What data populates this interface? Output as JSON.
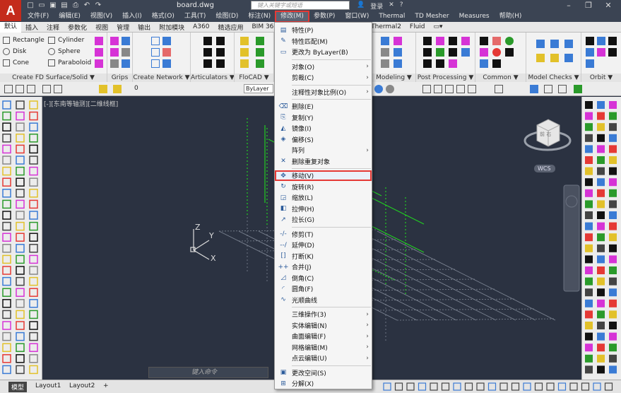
{
  "app": {
    "logo_letter": "A",
    "doc_title": "board.dwg",
    "search_placeholder": "键入关键字或短语",
    "login_label": "登录",
    "help_symbol": "?"
  },
  "menubar": {
    "items": [
      {
        "label": "文件(F)"
      },
      {
        "label": "编辑(E)"
      },
      {
        "label": "视图(V)"
      },
      {
        "label": "插入(I)"
      },
      {
        "label": "格式(O)"
      },
      {
        "label": "工具(T)"
      },
      {
        "label": "绘图(D)"
      },
      {
        "label": "标注(N)"
      },
      {
        "label": "修改(M)"
      },
      {
        "label": "参数(P)"
      },
      {
        "label": "窗口(W)"
      },
      {
        "label": "Thermal"
      },
      {
        "label": "TD Mesher"
      },
      {
        "label": "Measures"
      },
      {
        "label": "帮助(H)"
      }
    ],
    "active_index": 8
  },
  "ribbon_tabs": {
    "items": [
      "默认",
      "插入",
      "注释",
      "参数化",
      "视图",
      "管理",
      "输出",
      "附加模块",
      "A360",
      "精选应用",
      "BIM 360",
      "Thermal2",
      "Fluid"
    ],
    "selected": 0
  },
  "ribbon_panels": {
    "fd": {
      "title": "Create FD Surface/Solid ▼",
      "shapes": [
        {
          "label": "Rectangle"
        },
        {
          "label": "Disk"
        },
        {
          "label": "Cone"
        },
        {
          "label": "Cylinder"
        },
        {
          "label": "Sphere"
        },
        {
          "label": "Paraboloid"
        }
      ]
    },
    "grips": {
      "title": "Grips"
    },
    "network": {
      "title": "Create Network ▼"
    },
    "articulators": {
      "title": "Articulators ▼"
    },
    "flocad": {
      "title": "FloCAD ▼"
    },
    "modeling": {
      "title": "Modeling ▼"
    },
    "post": {
      "title": "Post Processing ▼"
    },
    "common": {
      "title": "Common ▼"
    },
    "model_checks": {
      "title": "Model Checks ▼"
    },
    "orbit": {
      "title": "Orbit ▼"
    }
  },
  "toolbar2": {
    "layer_value": "0",
    "bylayer": "ByLayer"
  },
  "viewport": {
    "label": "[-][东南等轴测][二维线框]",
    "wcs": "WCS",
    "cube_text": "前 右"
  },
  "dropdown": {
    "items": [
      {
        "icon": "▤",
        "label": "特性(P)",
        "submenu": false
      },
      {
        "icon": "✎",
        "label": "特性匹配(M)",
        "submenu": false
      },
      {
        "icon": "▭",
        "label": "更改为 ByLayer(B)",
        "submenu": false
      },
      {
        "icon": "",
        "label": "对象(O)",
        "submenu": true
      },
      {
        "icon": "",
        "label": "剪裁(C)",
        "submenu": true
      },
      {
        "icon": "",
        "label": "注释性对象比例(O)",
        "submenu": true
      },
      {
        "icon": "⌫",
        "label": "删除(E)",
        "submenu": false
      },
      {
        "icon": "⎘",
        "label": "复制(Y)",
        "submenu": false
      },
      {
        "icon": "◭",
        "label": "镜像(I)",
        "submenu": false
      },
      {
        "icon": "◈",
        "label": "偏移(S)",
        "submenu": false
      },
      {
        "icon": "",
        "label": "阵列",
        "submenu": true
      },
      {
        "icon": "✕",
        "label": "删除重复对象",
        "submenu": false
      },
      {
        "icon": "✥",
        "label": "移动(V)",
        "submenu": false
      },
      {
        "icon": "↻",
        "label": "旋转(R)",
        "submenu": false
      },
      {
        "icon": "◲",
        "label": "缩放(L)",
        "submenu": false
      },
      {
        "icon": "◧",
        "label": "拉伸(H)",
        "submenu": false
      },
      {
        "icon": "↗",
        "label": "拉长(G)",
        "submenu": false
      },
      {
        "icon": "-/-",
        "label": "修剪(T)",
        "submenu": false
      },
      {
        "icon": "--/",
        "label": "延伸(D)",
        "submenu": false
      },
      {
        "icon": "[]",
        "label": "打断(K)",
        "submenu": false
      },
      {
        "icon": "++",
        "label": "合并(J)",
        "submenu": false
      },
      {
        "icon": "◿",
        "label": "倒角(C)",
        "submenu": false
      },
      {
        "icon": "◜",
        "label": "圆角(F)",
        "submenu": false
      },
      {
        "icon": "∿",
        "label": "光顺曲线",
        "submenu": false
      },
      {
        "icon": "",
        "label": "三维操作(3)",
        "submenu": true
      },
      {
        "icon": "",
        "label": "实体编辑(N)",
        "submenu": true
      },
      {
        "icon": "",
        "label": "曲面编辑(F)",
        "submenu": true
      },
      {
        "icon": "",
        "label": "网格编辑(M)",
        "submenu": true
      },
      {
        "icon": "",
        "label": "点云编辑(U)",
        "submenu": true
      },
      {
        "icon": "▣",
        "label": "更改空间(S)",
        "submenu": false
      },
      {
        "icon": "⊞",
        "label": "分解(X)",
        "submenu": false
      }
    ],
    "highlighted_index": 12
  },
  "command": {
    "placeholder": "键入命令"
  },
  "status_tabs": [
    {
      "label": "模型"
    },
    {
      "label": "Layout1"
    },
    {
      "label": "Layout2"
    },
    {
      "label": "+"
    }
  ],
  "colors": {
    "accent_red": "#e53935",
    "canvas": "#2b3241",
    "green_lines": "#22cc22"
  }
}
